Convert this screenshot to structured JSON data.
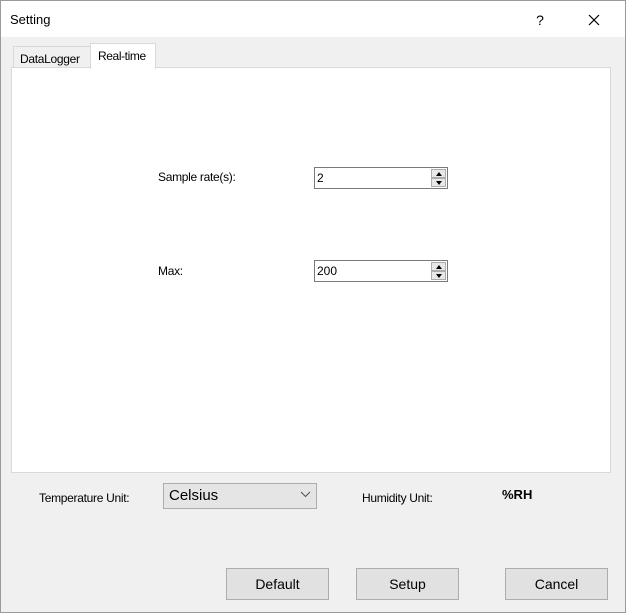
{
  "window": {
    "title": "Setting",
    "help": "?"
  },
  "tabs": [
    {
      "label": "DataLogger"
    },
    {
      "label": "Real-time"
    }
  ],
  "realtime": {
    "sample_rate_label": "Sample rate(s):",
    "sample_rate_value": "2",
    "max_label": "Max:",
    "max_value": "200"
  },
  "units": {
    "temperature_label": "Temperature Unit:",
    "temperature_value": "Celsius",
    "humidity_label": "Humidity Unit:",
    "humidity_value": "%RH"
  },
  "buttons": {
    "default": "Default",
    "setup": "Setup",
    "cancel": "Cancel"
  },
  "icons": {
    "close": "close-icon",
    "spin_up": "spin-up-icon",
    "spin_down": "spin-down-icon",
    "dropdown": "chevron-down-icon"
  }
}
